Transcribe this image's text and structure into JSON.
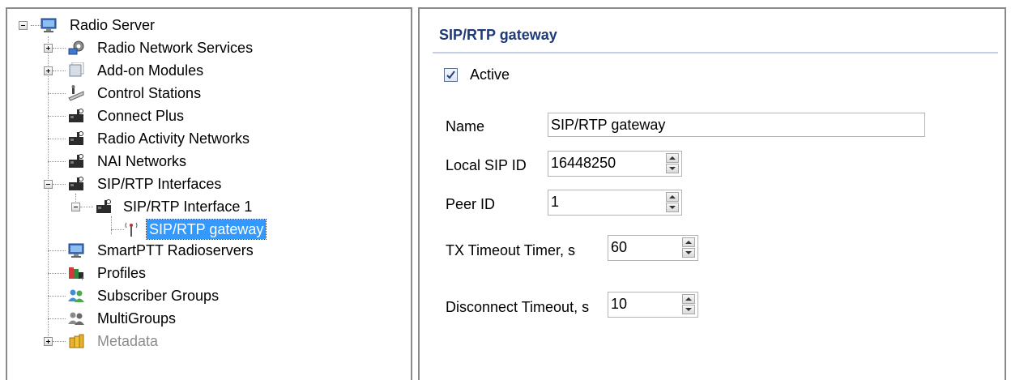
{
  "tree": {
    "root": "Radio Server",
    "items": [
      {
        "label": "Radio Network Services",
        "icon": "network-services-icon"
      },
      {
        "label": "Add-on Modules",
        "icon": "addon-modules-icon"
      },
      {
        "label": "Control Stations",
        "icon": "control-stations-icon"
      },
      {
        "label": "Connect Plus",
        "icon": "radio-network-icon"
      },
      {
        "label": "Radio Activity Networks",
        "icon": "radio-network-icon"
      },
      {
        "label": "NAI Networks",
        "icon": "radio-network-icon"
      },
      {
        "label": "SIP/RTP Interfaces",
        "icon": "radio-network-icon"
      },
      {
        "label": "SIP/RTP Interface 1",
        "icon": "radio-network-icon"
      },
      {
        "label": "SIP/RTP gateway",
        "icon": "antenna-icon"
      },
      {
        "label": "SmartPTT Radioservers",
        "icon": "computer-icon"
      },
      {
        "label": "Profiles",
        "icon": "profiles-icon"
      },
      {
        "label": "Subscriber Groups",
        "icon": "subscriber-groups-icon"
      },
      {
        "label": "MultiGroups",
        "icon": "multigroups-icon"
      },
      {
        "label": "Metadata",
        "icon": "metadata-icon"
      }
    ]
  },
  "panel": {
    "title": "SIP/RTP gateway",
    "active_label": "Active",
    "active_checked": true,
    "name_label": "Name",
    "name_value": "SIP/RTP gateway",
    "local_sip_label": "Local SIP ID",
    "local_sip_value": "16448250",
    "peer_label": "Peer ID",
    "peer_value": "1",
    "tx_label": "TX Timeout Timer, s",
    "tx_value": "60",
    "disc_label": "Disconnect Timeout, s",
    "disc_value": "10"
  },
  "colors": {
    "selection": "#3399ff",
    "title_text": "#1f3a78"
  }
}
